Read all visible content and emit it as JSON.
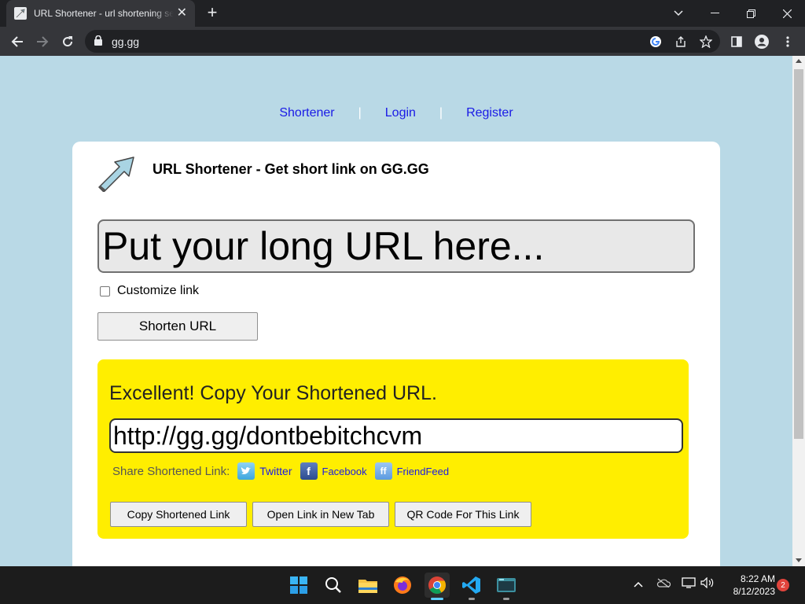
{
  "browser": {
    "tab_title": "URL Shortener - url shortening service",
    "url": "gg.gg",
    "new_tab_symbol": "+",
    "tab_close_symbol": "✕"
  },
  "page": {
    "nav": [
      "Shortener",
      "Login",
      "Register"
    ],
    "nav_separator": "|",
    "title": "URL Shortener - Get short link on GG.GG",
    "long_url_placeholder": "Put your long URL here...",
    "customize_label": "Customize link",
    "shorten_button": "Shorten URL",
    "result": {
      "heading": "Excellent! Copy Your Shortened URL.",
      "short_url": "http://gg.gg/dontbebitchcvm",
      "share_label": "Share Shortened Link:",
      "share": [
        {
          "label": "Twitter",
          "icon": "twitter-icon"
        },
        {
          "label": "Facebook",
          "icon": "facebook-icon"
        },
        {
          "label": "FriendFeed",
          "icon": "friendfeed-icon"
        }
      ],
      "buttons": [
        "Copy Shortened Link",
        "Open Link in New Tab",
        "QR Code For This Link"
      ]
    },
    "colors": {
      "page_background": "#b9d9e6",
      "result_background": "#ffee00",
      "link": "#1a1ae6"
    }
  },
  "taskbar": {
    "time": "8:22 AM",
    "date": "8/12/2023",
    "notification_count": "2"
  }
}
